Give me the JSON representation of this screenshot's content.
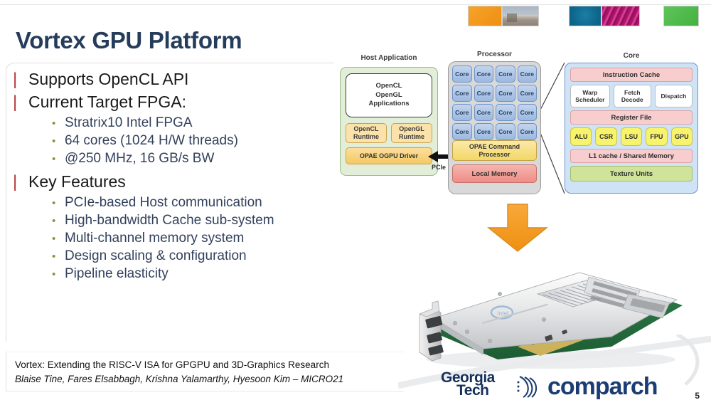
{
  "slide": {
    "title": "Vortex GPU Platform",
    "page_number": "5"
  },
  "banner": {
    "chips": [
      {
        "name": "chip-orange",
        "color": "#ef8f12"
      },
      {
        "name": "chip-photo",
        "color": "#aab6c4"
      },
      {
        "name": "chip-teal",
        "color": "#0d6489"
      },
      {
        "name": "chip-pink",
        "color": "#b2116b"
      },
      {
        "name": "chip-green",
        "color": "#43b23f"
      }
    ]
  },
  "bullets": [
    {
      "level": 1,
      "marker": "|",
      "text": "Supports OpenCL API",
      "children": []
    },
    {
      "level": 1,
      "marker": "|",
      "text": "Current Target FPGA:",
      "children": [
        {
          "marker": "•",
          "text": "Stratrix10 Intel FPGA"
        },
        {
          "marker": "•",
          "text": "64 cores (1024 H/W threads)"
        },
        {
          "marker": "•",
          "text": "@250 MHz, 16 GB/s BW"
        }
      ]
    },
    {
      "level": 1,
      "marker": "|",
      "text": "Key Features",
      "children": [
        {
          "marker": "•",
          "text": "PCIe-based Host communication"
        },
        {
          "marker": "•",
          "text": "High-bandwidth Cache sub-system"
        },
        {
          "marker": "•",
          "text": "Multi-channel memory system"
        },
        {
          "marker": "•",
          "text": "Design scaling & configuration"
        },
        {
          "marker": "•",
          "text": "Pipeline elasticity"
        }
      ]
    }
  ],
  "citation": {
    "line1": "Vortex: Extending the RISC-V ISA for GPGPU and 3D-Graphics Research",
    "line2": "Blaise Tine, Fares Elsabbagh, Krishna Yalamarthy, Hyesoon Kim – MICRO21"
  },
  "diagram": {
    "host": {
      "label": "Host Application",
      "apps_box": [
        "OpenCL",
        "OpenGL",
        "Applications"
      ],
      "runtimes": [
        {
          "line1": "OpenCL",
          "line2": "Runtime"
        },
        {
          "line1": "OpenGL",
          "line2": "Runtime"
        }
      ],
      "driver": "OPAE OGPU Driver"
    },
    "interconnect": {
      "label": "PCIe",
      "icon": "bidirectional-arrow-icon"
    },
    "processor": {
      "label": "Processor",
      "core_label": "Core",
      "core_count": 16,
      "command_processor": {
        "line1": "OPAE Command",
        "line2": "Processor"
      },
      "local_memory": "Local Memory"
    },
    "core": {
      "label": "Core",
      "instruction_cache": "Instruction Cache",
      "front_end": [
        {
          "line1": "Warp",
          "line2": "Scheduler"
        },
        {
          "line1": "Fetch",
          "line2": "Decode"
        },
        {
          "line1": "Dispatch",
          "line2": ""
        }
      ],
      "register_file": "Register File",
      "exec_units": [
        "ALU",
        "CSR",
        "LSU",
        "FPU",
        "GPU"
      ],
      "l1_cache": "L1 cache / Shared Memory",
      "texture_units": "Texture Units"
    },
    "flow_arrow": "down-arrow-icon"
  },
  "photo": {
    "name": "intel-fpga-pcie-card-photo",
    "alt": "Intel Stratix 10 FPGA PCIe accelerator card"
  },
  "logos": {
    "georgia_tech": {
      "line1": "Georgia",
      "line2": "Tech"
    },
    "comparch": {
      "mark": "comparch-swirl-icon",
      "text": "comparch"
    }
  },
  "colors": {
    "title": "#253d5b",
    "bullet_level1_marker": "#b53737",
    "bullet_level2_marker": "#7b9b3f",
    "bullet_level2_text": "#33415c",
    "accent_orange": "#ef8f12",
    "host_panel": "#e3eed9",
    "core_blue": "#9cb9e0",
    "core_panel": "#cfe3f6",
    "pink_block": "#f8cdcd",
    "yellow_unit": "#f7f36c",
    "green_block": "#cfe39a",
    "local_memory": "#ef8d87",
    "comparch_blue": "#1b3d73",
    "gt_navy": "#16305c"
  }
}
